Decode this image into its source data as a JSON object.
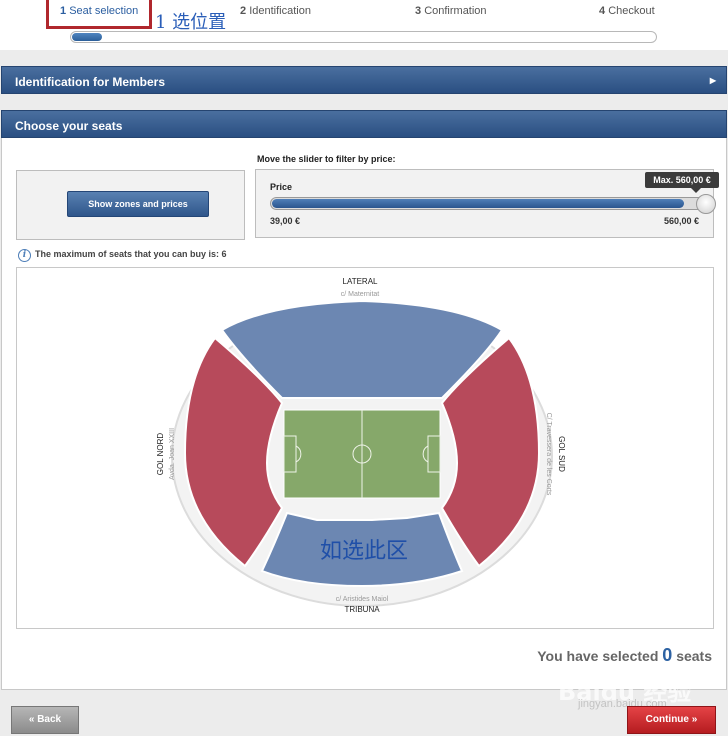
{
  "steps": [
    {
      "num": "1",
      "label": "Seat selection"
    },
    {
      "num": "2",
      "label": "Identification"
    },
    {
      "num": "3",
      "label": "Confirmation"
    },
    {
      "num": "4",
      "label": "Checkout"
    }
  ],
  "annotation_step": "1 选位置",
  "progress_fraction": 0.05,
  "members_header": "Identification for Members",
  "seats_header": "Choose your seats",
  "zones_button": "Show zones and prices",
  "slider": {
    "title": "Move the slider to filter by price:",
    "label": "Price",
    "min": "39,00 €",
    "max": "560,00 €",
    "tooltip": "Max. 560,00 €",
    "value_fraction": 1.0
  },
  "max_seats_text": "The maximum of seats that you can buy is: 6",
  "stadium": {
    "lateral": "LATERAL",
    "lateral_street": "c/ Maternitat",
    "gol_nord": "GOL NORD",
    "gol_nord_street": "Avda. Joan XXIII",
    "gol_sud": "GOL SUD",
    "gol_sud_street": "C/ Travessera de les Corts",
    "tribuna": "TRIBUNA",
    "tribuna_street": "c/ Aristides Maiol",
    "annotation": "如选此区"
  },
  "selected": {
    "prefix": "You have selected",
    "count": "0",
    "suffix": "seats"
  },
  "back_button": "« Back",
  "continue_button": "Continue »",
  "watermark": "Baidu 经验",
  "watermark_sub": "jingyan.baidu.com",
  "colors": {
    "accent_blue": "#2d62a3",
    "zone_blue": "#6c87b2",
    "zone_red": "#b74a5b",
    "pitch_green": "#86a86a",
    "continue_red": "#c8272b"
  }
}
